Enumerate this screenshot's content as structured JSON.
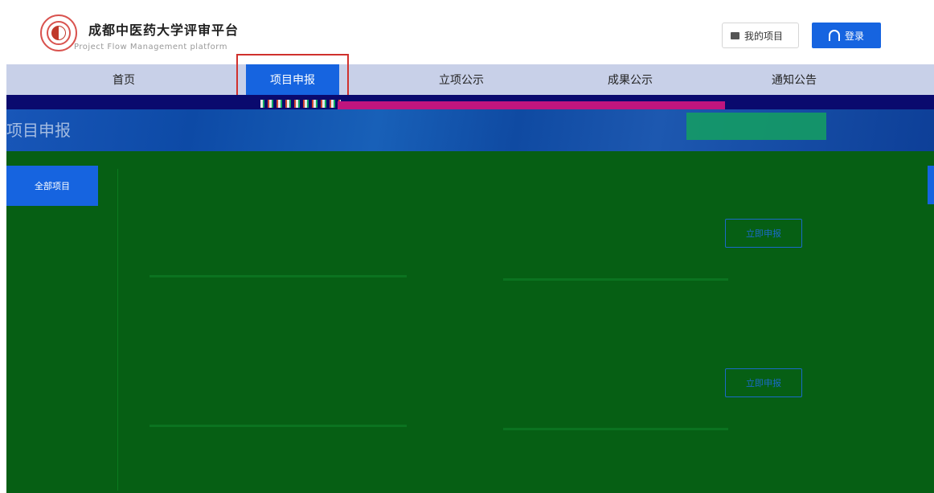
{
  "brand": {
    "title": "成都中医药大学评审平台",
    "subtitle": "Project Flow Management platform"
  },
  "header": {
    "my_projects_label": "我的项目",
    "login_label": "登录"
  },
  "nav": {
    "items": [
      {
        "label": "首页"
      },
      {
        "label": "项目申报"
      },
      {
        "label": "立项公示"
      },
      {
        "label": "成果公示"
      },
      {
        "label": "通知公告"
      }
    ],
    "active_index": 1
  },
  "banner": {
    "title": "项目申报"
  },
  "sidebar": {
    "items": [
      {
        "label": "全部项目"
      }
    ]
  },
  "projects": [
    {
      "apply_label": "立即申报"
    },
    {
      "apply_label": "立即申报"
    }
  ],
  "colors": {
    "primary": "#1664e0",
    "nav_bg": "#c8d0e8",
    "highlight": "#d0312d",
    "content_bg": "#065f14"
  }
}
